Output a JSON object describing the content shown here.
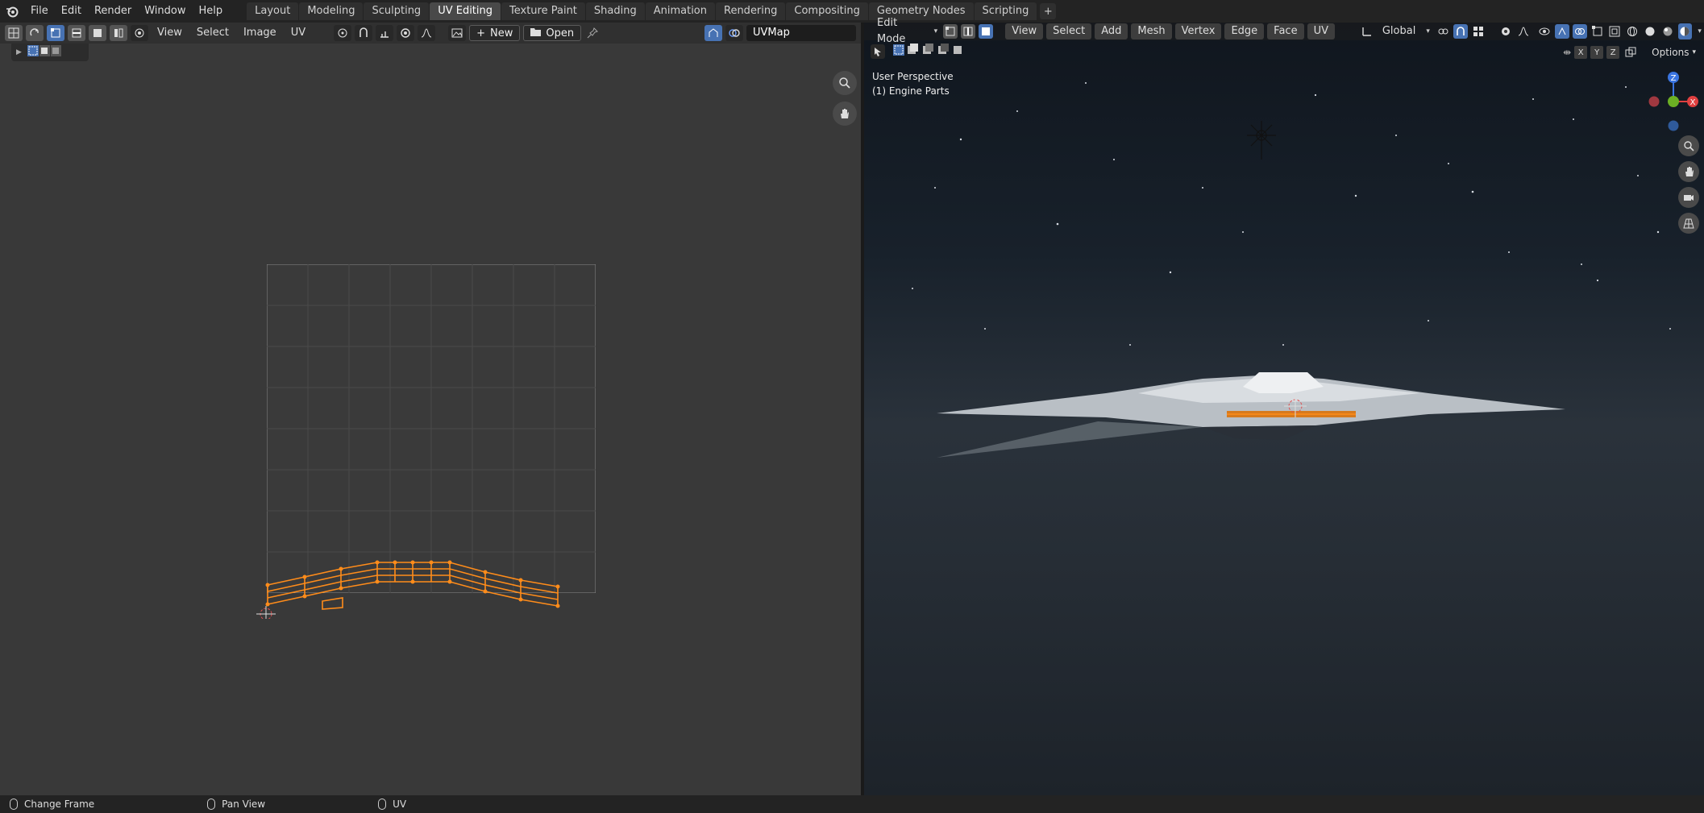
{
  "menubar": {
    "items": [
      "File",
      "Edit",
      "Render",
      "Window",
      "Help"
    ]
  },
  "workspaces": {
    "tabs": [
      "Layout",
      "Modeling",
      "Sculpting",
      "UV Editing",
      "Texture Paint",
      "Shading",
      "Animation",
      "Rendering",
      "Compositing",
      "Geometry Nodes",
      "Scripting"
    ],
    "active": "UV Editing"
  },
  "uv_editor": {
    "menus": [
      "View",
      "Select",
      "Image",
      "UV"
    ],
    "new_label": "New",
    "open_label": "Open",
    "uvmap_field": "UVMap"
  },
  "viewport": {
    "mode": "Edit Mode",
    "menus": [
      "View",
      "Select",
      "Add",
      "Mesh",
      "Vertex",
      "Edge",
      "Face",
      "UV"
    ],
    "orientation": "Global",
    "perspective_label": "User Perspective",
    "object_label": "(1) Engine Parts",
    "options_label": "Options",
    "axes": [
      "X",
      "Y",
      "Z"
    ]
  },
  "statusbar": {
    "items": [
      "Change Frame",
      "Pan View",
      "UV"
    ]
  },
  "colors": {
    "accent": "#4772b3",
    "selection": "#ff8c1a"
  }
}
